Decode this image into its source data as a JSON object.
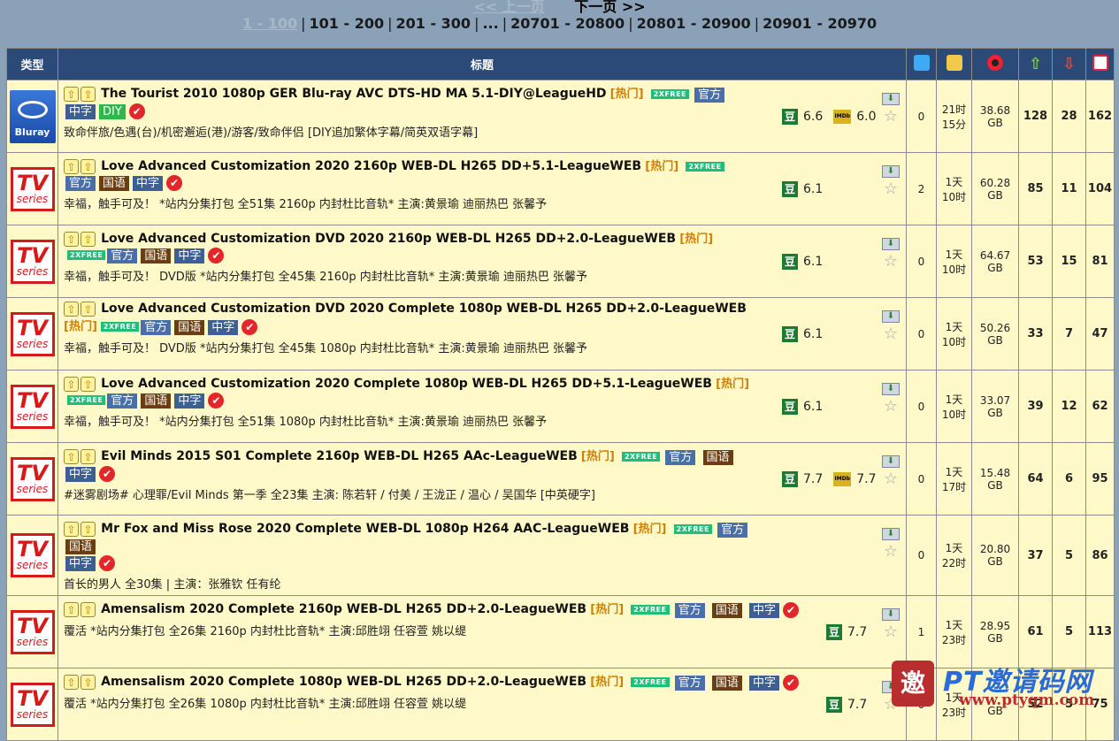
{
  "pager": {
    "prev": "<< 上一页",
    "next": "下一页 >>",
    "ranges": [
      "1 - 100",
      "101 - 200",
      "201 - 300",
      "...",
      "20701 - 20800",
      "20801 - 20900",
      "20901 - 20970"
    ]
  },
  "table": {
    "headers": {
      "type": "类型",
      "title": "标题"
    },
    "tags": {
      "hot": "热门",
      "free": "2XFREE",
      "official": "官方",
      "mandarin": "国语",
      "chinese": "中字",
      "diy": "DIY"
    },
    "rating_labels": {
      "douban": "豆",
      "imdb": "IMDb"
    },
    "category_labels": {
      "bluray_text": "Bluray",
      "tv_top": "TV",
      "tv_bottom": "series"
    },
    "rows": [
      {
        "title": "The Tourist 2010 1080p GER Blu-ray AVC DTS-HD MA 5.1-DIY@LeagueHD",
        "subtitle": "致命伴旅/色遇(台)/机密邂逅(港)/游客/致命伴侣 [DIY追加繁体字幕/简英双语字幕]",
        "douban": "6.6",
        "imdb": "6.0",
        "comments": "0",
        "time1": "21时",
        "time2": "15分",
        "size1": "38.68",
        "size2": "GB",
        "seeders": "128",
        "leechers": "28",
        "completed": "162"
      },
      {
        "title": "Love Advanced Customization 2020 2160p WEB-DL H265 DD+5.1-LeagueWEB",
        "subtitle": "幸福，触手可及！ *站内分集打包 全51集 2160p 内封杜比音轨* 主演:黄景瑜 迪丽热巴 张馨予",
        "douban": "6.1",
        "comments": "2",
        "time1": "1天",
        "time2": "10时",
        "size1": "60.28",
        "size2": "GB",
        "seeders": "85",
        "leechers": "11",
        "completed": "104"
      },
      {
        "title": "Love Advanced Customization DVD 2020 2160p WEB-DL H265 DD+2.0-LeagueWEB",
        "subtitle": "幸福，触手可及！ DVD版 *站内分集打包 全45集 2160p 内封杜比音轨* 主演:黄景瑜 迪丽热巴 张馨予",
        "douban": "6.1",
        "comments": "0",
        "time1": "1天",
        "time2": "10时",
        "size1": "64.67",
        "size2": "GB",
        "seeders": "53",
        "leechers": "15",
        "completed": "81"
      },
      {
        "title": "Love Advanced Customization DVD 2020 Complete 1080p WEB-DL H265 DD+2.0-LeagueWEB",
        "subtitle": "幸福，触手可及！ DVD版 *站内分集打包 全45集 1080p 内封杜比音轨* 主演:黄景瑜 迪丽热巴 张馨予",
        "douban": "6.1",
        "comments": "0",
        "time1": "1天",
        "time2": "10时",
        "size1": "50.26",
        "size2": "GB",
        "seeders": "33",
        "leechers": "7",
        "completed": "47"
      },
      {
        "title": "Love Advanced Customization 2020 Complete 1080p WEB-DL H265 DD+5.1-LeagueWEB",
        "subtitle": "幸福，触手可及！ *站内分集打包 全51集 1080p 内封杜比音轨* 主演:黄景瑜 迪丽热巴 张馨予",
        "douban": "6.1",
        "comments": "0",
        "time1": "1天",
        "time2": "10时",
        "size1": "33.07",
        "size2": "GB",
        "seeders": "39",
        "leechers": "12",
        "completed": "62"
      },
      {
        "title": "Evil Minds 2015 S01 Complete 2160p WEB-DL H265 AAc-LeagueWEB",
        "subtitle": "#迷雾剧场# 心理罪/Evil Minds 第一季 全23集 主演: 陈若轩 / 付美 / 王泷正 / 温心 / 吴国华 [中英硬字]",
        "douban": "7.7",
        "imdb": "7.7",
        "comments": "0",
        "time1": "1天",
        "time2": "17时",
        "size1": "15.48",
        "size2": "GB",
        "seeders": "64",
        "leechers": "6",
        "completed": "95"
      },
      {
        "title": "Mr Fox and Miss Rose 2020 Complete WEB-DL 1080p H264 AAC-LeagueWEB",
        "subtitle": "首长的男人 全30集 | 主演：张雅钦 任有纶",
        "douban": "",
        "comments": "0",
        "time1": "1天",
        "time2": "22时",
        "size1": "20.80",
        "size2": "GB",
        "seeders": "37",
        "leechers": "5",
        "completed": "86"
      },
      {
        "title": "Amensalism 2020 Complete 2160p WEB-DL H265 DD+2.0-LeagueWEB",
        "subtitle": "覆活 *站内分集打包 全26集 2160p 内封杜比音轨* 主演:邱胜翊 任容萱 姚以缇",
        "douban": "7.7",
        "comments": "1",
        "time1": "1天",
        "time2": "23时",
        "size1": "28.95",
        "size2": "GB",
        "seeders": "61",
        "leechers": "5",
        "completed": "113"
      },
      {
        "title": "Amensalism 2020 Complete 1080p WEB-DL H265 DD+2.0-LeagueWEB",
        "subtitle": "覆活 *站内分集打包 全26集 1080p 内封杜比音轨* 主演:邱胜翊 任容萱 姚以缇",
        "douban": "7.7",
        "comments": "0",
        "time1": "1天",
        "time2": "23时",
        "size1": "",
        "size2": "GB",
        "seeders": "52",
        "leechers": "5",
        "completed": "75"
      }
    ]
  },
  "watermark": {
    "seal": "邀",
    "brand": "PT邀请码网",
    "url": "www.ptyqm.com"
  },
  "colors": {
    "header_bg": "#2c4a78",
    "row_bg": "#fff8c8",
    "page_bg": "#8aa1b8",
    "hot": "#d08000",
    "free": "#1fbf7a"
  }
}
